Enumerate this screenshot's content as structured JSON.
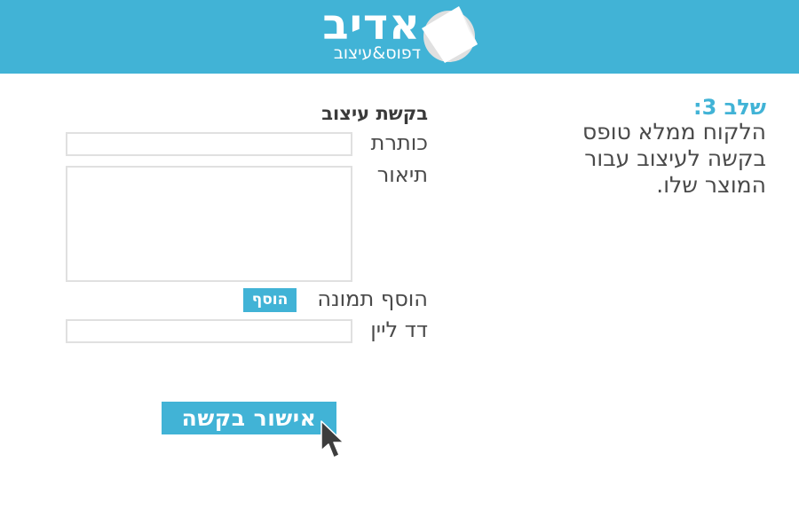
{
  "header": {
    "logo_title": "אדיב",
    "logo_subtitle": "דפוס&עיצוב",
    "logo_icon": "folded-paper-icon"
  },
  "step": {
    "title": "שלב 3:",
    "description": "הלקוח ממלא טופס בקשה לעיצוב עבור המוצר שלו."
  },
  "form": {
    "title": "בקשת עיצוב",
    "title_label": "כותרת",
    "title_value": "",
    "description_label": "תיאור",
    "description_value": "",
    "add_image_label": "הוסף תמונה",
    "add_button_label": "הוסף",
    "landing_label": "דד ליין",
    "landing_value": "",
    "submit_label": "אישור בקשה"
  },
  "cursor_icon": "mouse-pointer-icon",
  "colors": {
    "accent": "#41b3d6",
    "text": "#3a3a3a",
    "field_border": "#e0e0e0"
  }
}
